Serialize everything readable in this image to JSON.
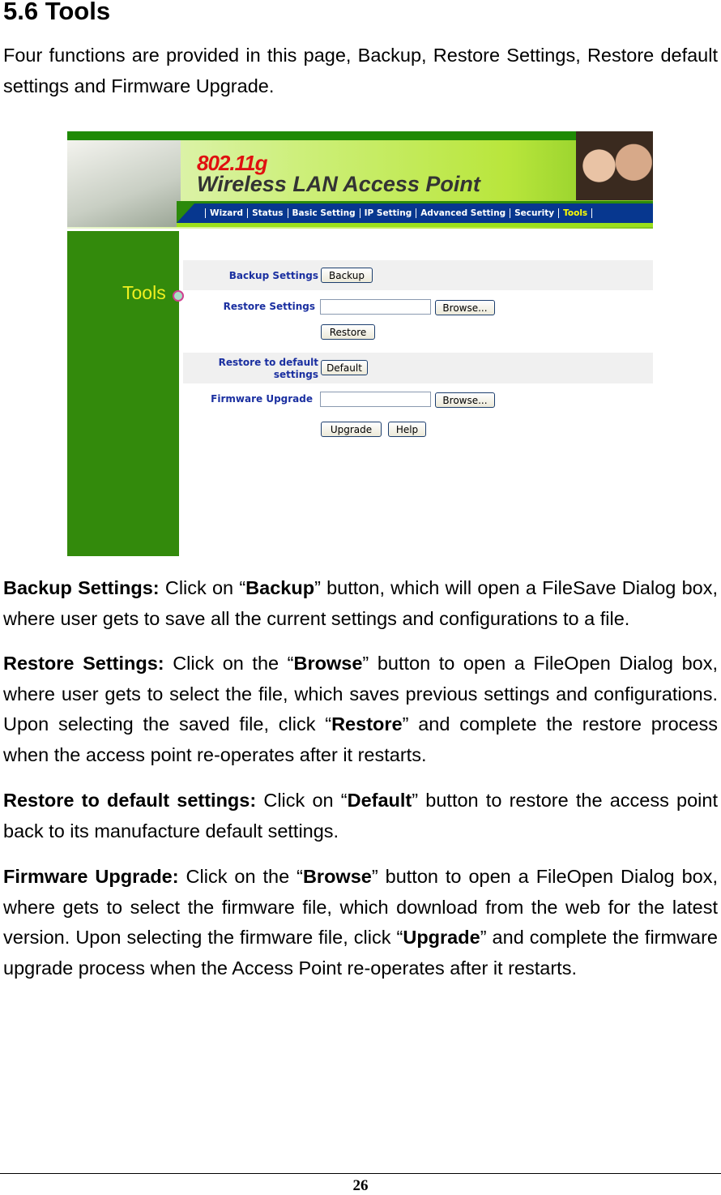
{
  "heading": "5.6 Tools",
  "intro": "Four functions are provided in this page, Backup, Restore Settings, Restore default settings and Firmware Upgrade.",
  "screenshot": {
    "brand_line1": "802.11g",
    "brand_line2": "Wireless LAN Access Point",
    "nav": [
      "Wizard",
      "Status",
      "Basic  Setting",
      "IP Setting",
      "Advanced Setting",
      "Security",
      "Tools"
    ],
    "active_nav": "Tools",
    "sidebar_title": "Tools",
    "backup_label": "Backup Settings",
    "backup_button": "Backup",
    "restore_label": "Restore Settings",
    "browse_button": "Browse...",
    "restore_button": "Restore",
    "default_label_1": "Restore to default",
    "default_label_2": "settings",
    "default_button": "Default",
    "firmware_label": "Firmware Upgrade",
    "upgrade_button": "Upgrade",
    "help_button": "Help",
    "restore_file_value": "",
    "firmware_file_value": "",
    "colors": {
      "nav_bg": "#07378f",
      "sidebar": "#338a0c",
      "label": "#1a2fa0",
      "active_nav": "#ffff00"
    }
  },
  "paragraphs": [
    [
      "Backup Settings:",
      " Click on “",
      "Backup",
      "” button, which will open a FileSave Dialog box, where user gets to save all the current settings and configurations to a file."
    ],
    [
      "Restore Settings:",
      " Click on the “",
      "Browse",
      "” button to open a FileOpen Dialog box, where user gets to select the file, which saves previous settings and configurations.  Upon selecting the saved file, click “",
      "Restore",
      "” and complete the restore process when the access point re-operates after it restarts."
    ],
    [
      "Restore to default settings:",
      " Click on “",
      "Default",
      "” button to restore the access point back to its manufacture default settings."
    ],
    [
      "Firmware Upgrade:",
      " Click on the “",
      "Browse",
      "” button to open a FileOpen Dialog box, where gets to select the firmware file, which download from the web for the latest version.  Upon selecting the firmware file, click “",
      "Upgrade",
      "” and complete the firmware upgrade process when the Access Point re-operates after it restarts."
    ]
  ],
  "page_number": "26"
}
